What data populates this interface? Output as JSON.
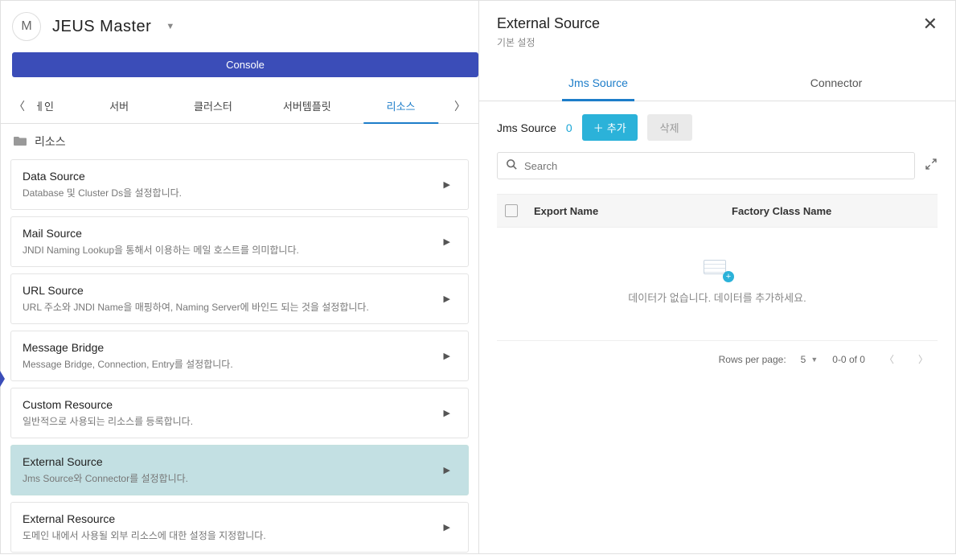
{
  "header": {
    "avatar_letter": "M",
    "app_title": "JEUS Master",
    "console_label": "Console"
  },
  "nav_tabs": {
    "partial": "ㅔ인",
    "items": [
      "서버",
      "클러스터",
      "서버템플릿",
      "리소스"
    ],
    "active": "리소스"
  },
  "section": {
    "title": "리소스"
  },
  "cards": [
    {
      "title": "Data Source",
      "desc": "Database 및 Cluster Ds을 설정합니다.",
      "active": false
    },
    {
      "title": "Mail Source",
      "desc": "JNDI Naming Lookup을 통해서 이용하는 메일 호스트를 의미합니다.",
      "active": false
    },
    {
      "title": "URL Source",
      "desc": "URL 주소와 JNDI Name을 매핑하여, Naming Server에 바인드 되는 것을 설정합니다.",
      "active": false
    },
    {
      "title": "Message Bridge",
      "desc": "Message Bridge, Connection, Entry를 설정합니다.",
      "active": false
    },
    {
      "title": "Custom Resource",
      "desc": "일반적으로 사용되는 리소스를 등록합니다.",
      "active": false
    },
    {
      "title": "External Source",
      "desc": "Jms Source와 Connector를 설정합니다.",
      "active": true
    },
    {
      "title": "External Resource",
      "desc": "도메인 내에서 사용될 외부 리소스에 대한 설정을 지정합니다.",
      "active": false
    }
  ],
  "right": {
    "title": "External Source",
    "subtitle": "기본 설정",
    "tabs": [
      "Jms Source",
      "Connector"
    ],
    "active_tab": "Jms Source",
    "toolbar": {
      "label": "Jms Source",
      "count": "0",
      "add_label": "추가",
      "delete_label": "삭제"
    },
    "search_placeholder": "Search",
    "columns": [
      "Export Name",
      "Factory Class Name"
    ],
    "empty_message": "데이터가 없습니다. 데이터를 추가하세요.",
    "pagination": {
      "rows_label": "Rows per page:",
      "page_size": "5",
      "range": "0-0 of 0"
    }
  }
}
